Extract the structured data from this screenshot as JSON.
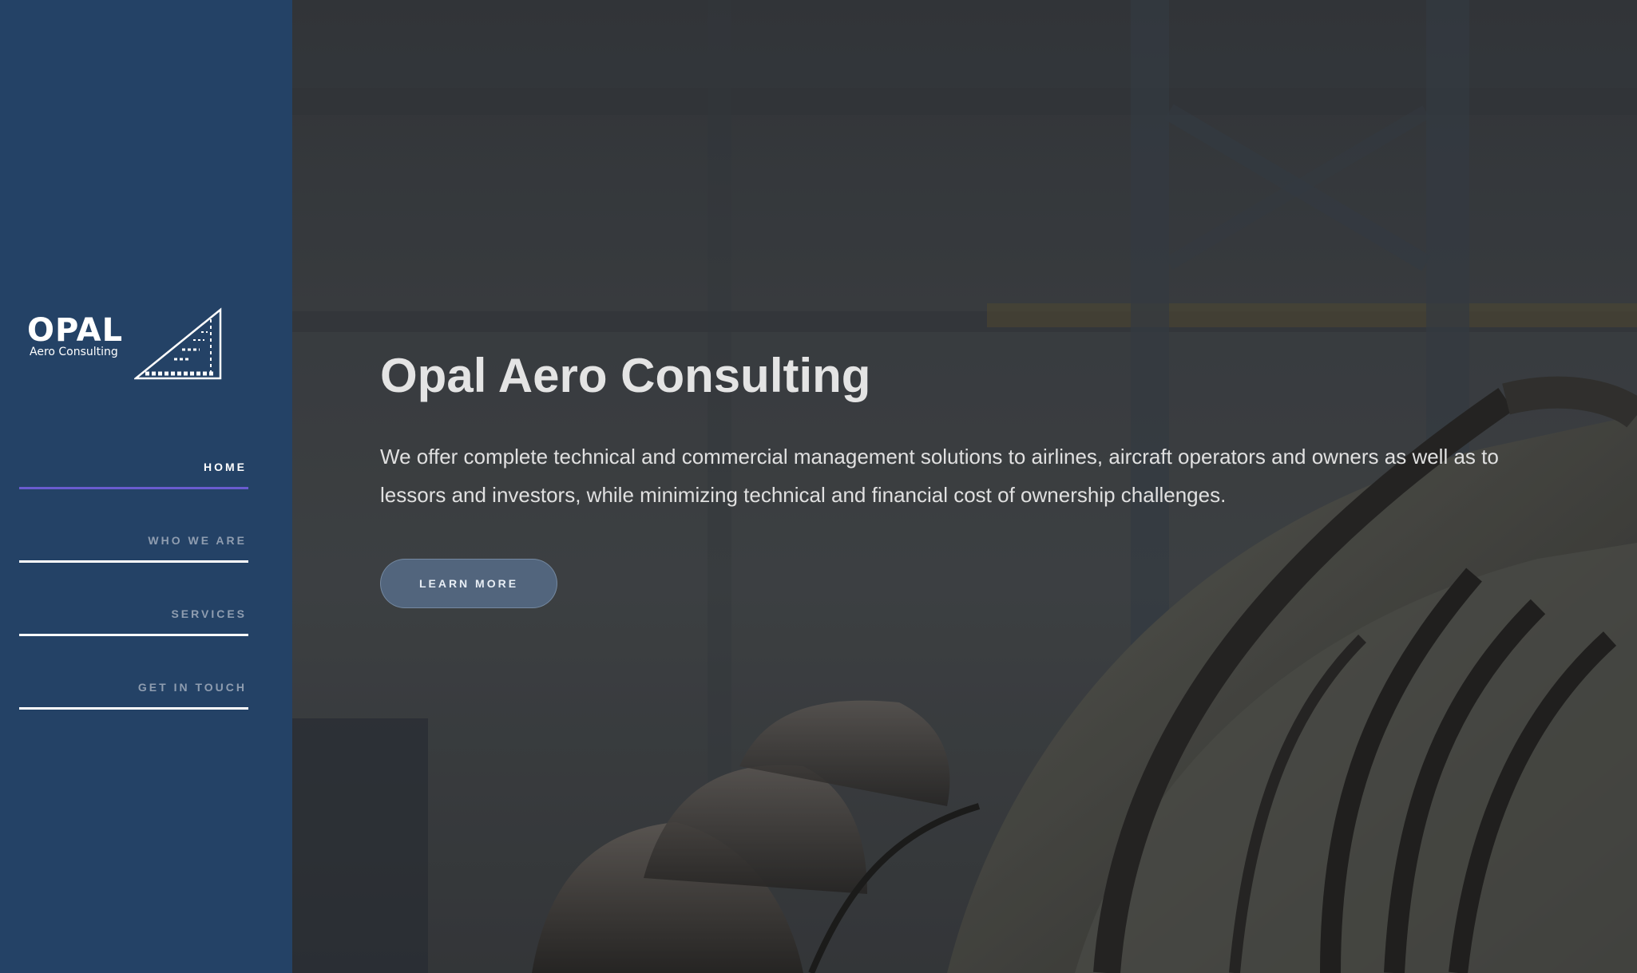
{
  "brand": {
    "wordmark": "OPAL",
    "tagline": "Aero Consulting"
  },
  "nav": {
    "items": [
      {
        "label": "HOME",
        "active": true
      },
      {
        "label": "WHO WE ARE",
        "active": false
      },
      {
        "label": "SERVICES",
        "active": false
      },
      {
        "label": "GET IN TOUCH",
        "active": false
      }
    ]
  },
  "hero": {
    "title": "Opal Aero Consulting",
    "text": "We offer complete technical and commercial management solutions to airlines, aircraft operators and owners as well as to lessors and investors, while minimizing technical and financial cost of ownership challenges.",
    "cta_label": "LEARN MORE"
  },
  "colors": {
    "sidebar": "#244266",
    "active_underline": "#6a5ccf",
    "nav_inactive": "#8f9db0"
  }
}
